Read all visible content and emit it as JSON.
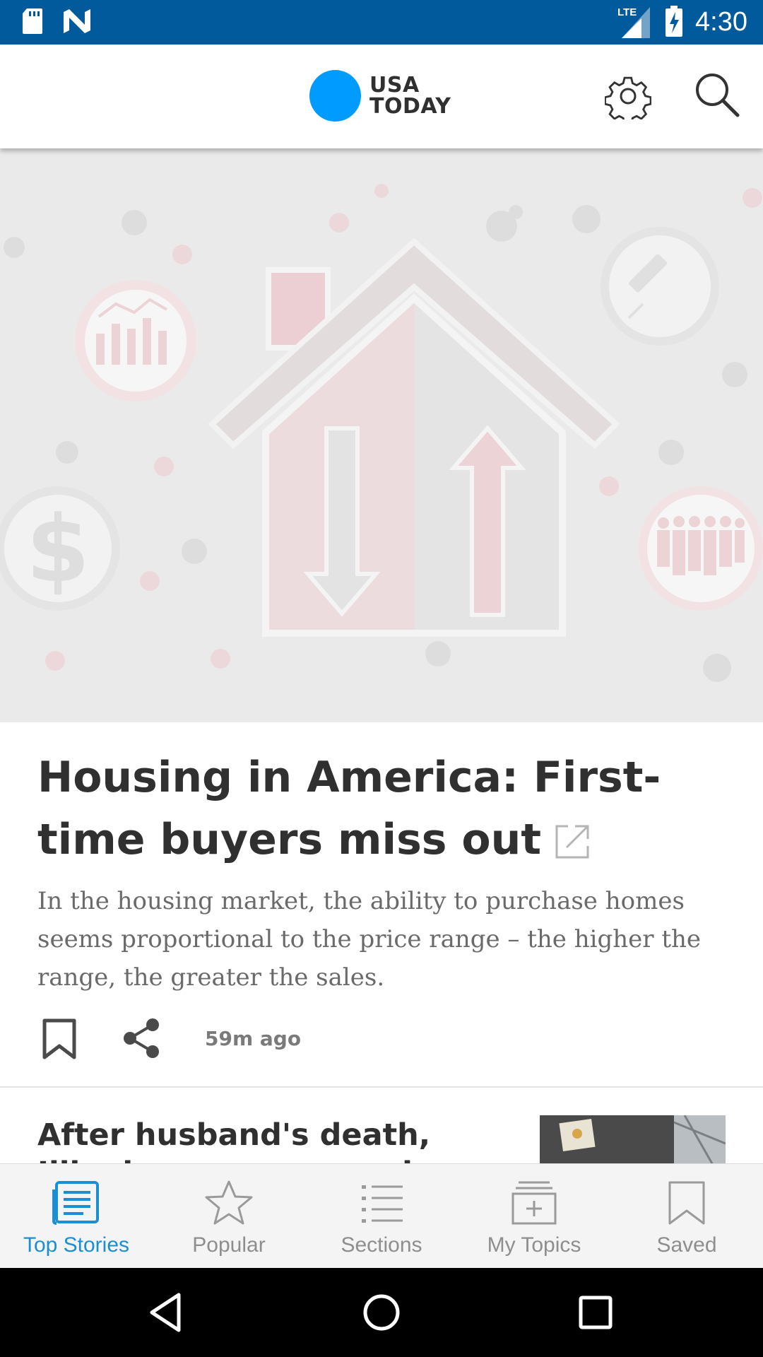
{
  "status_bar": {
    "time": "4:30",
    "network": "LTE",
    "icons": [
      "sd-card-icon",
      "n-notification-icon",
      "lte-signal-icon",
      "battery-charging-icon"
    ]
  },
  "app_bar": {
    "logo_line1": "USA",
    "logo_line2": "TODAY",
    "logo_color": "#009bff",
    "icons": [
      "gear-icon",
      "search-icon"
    ]
  },
  "hero": {
    "icons": [
      "house-icon",
      "chart-icon",
      "syringe-icon",
      "dollar-icon",
      "people-icon",
      "arrow-down-icon",
      "arrow-up-icon"
    ]
  },
  "article": {
    "headline": "Housing in America:  First-time buyers miss out",
    "summary": "In the housing market, the ability to purchase homes seems proportional to the price range – the higher the range, the greater the sales.",
    "timestamp": "59m ago",
    "icons": [
      "external-link-icon",
      "bookmark-icon",
      "share-icon"
    ]
  },
  "article2": {
    "headline": "After husband's death, Illinois woman spread COVID"
  },
  "bottom_nav": {
    "active_color": "#1b8fd1",
    "items": [
      {
        "label": "Top Stories",
        "icon": "top-stories-icon",
        "active": true
      },
      {
        "label": "Popular",
        "icon": "star-icon",
        "active": false
      },
      {
        "label": "Sections",
        "icon": "list-icon",
        "active": false
      },
      {
        "label": "My Topics",
        "icon": "topics-plus-icon",
        "active": false
      },
      {
        "label": "Saved",
        "icon": "bookmark-icon",
        "active": false
      }
    ]
  },
  "system_nav": {
    "icons": [
      "back-icon",
      "home-icon",
      "recents-icon"
    ]
  }
}
